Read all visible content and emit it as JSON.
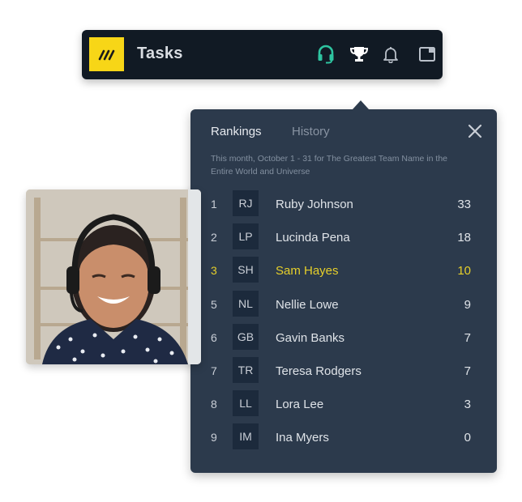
{
  "topbar": {
    "logo_icon": "slash-logo-icon",
    "title": "Tasks",
    "icons": [
      "headset-icon",
      "trophy-icon",
      "bell-icon",
      "window-icon"
    ],
    "colors": {
      "logo_bg": "#f7d617",
      "headset": "#2ec4a0",
      "bar_bg": "#111a24"
    }
  },
  "popover": {
    "tabs": [
      {
        "label": "Rankings",
        "active": true
      },
      {
        "label": "History",
        "active": false
      }
    ],
    "close_icon": "close-icon",
    "subtitle": "This month, October 1 - 31 for The Greatest Team Name in the Entire World and Universe",
    "highlight_color": "#e6cf2a",
    "rows": [
      {
        "rank": "1",
        "initials": "RJ",
        "name": "Ruby Johnson",
        "score": "33",
        "highlight": false
      },
      {
        "rank": "2",
        "initials": "LP",
        "name": "Lucinda Pena",
        "score": "18",
        "highlight": false
      },
      {
        "rank": "3",
        "initials": "SH",
        "name": "Sam Hayes",
        "score": "10",
        "highlight": true
      },
      {
        "rank": "5",
        "initials": "NL",
        "name": "Nellie Lowe",
        "score": "9",
        "highlight": false
      },
      {
        "rank": "6",
        "initials": "GB",
        "name": "Gavin Banks",
        "score": "7",
        "highlight": false
      },
      {
        "rank": "7",
        "initials": "TR",
        "name": "Teresa Rodgers",
        "score": "7",
        "highlight": false
      },
      {
        "rank": "8",
        "initials": "LL",
        "name": "Lora Lee",
        "score": "3",
        "highlight": false
      },
      {
        "rank": "9",
        "initials": "IM",
        "name": "Ina Myers",
        "score": "0",
        "highlight": false
      }
    ]
  },
  "photo": {
    "description": "Smiling woman wearing a headset"
  }
}
